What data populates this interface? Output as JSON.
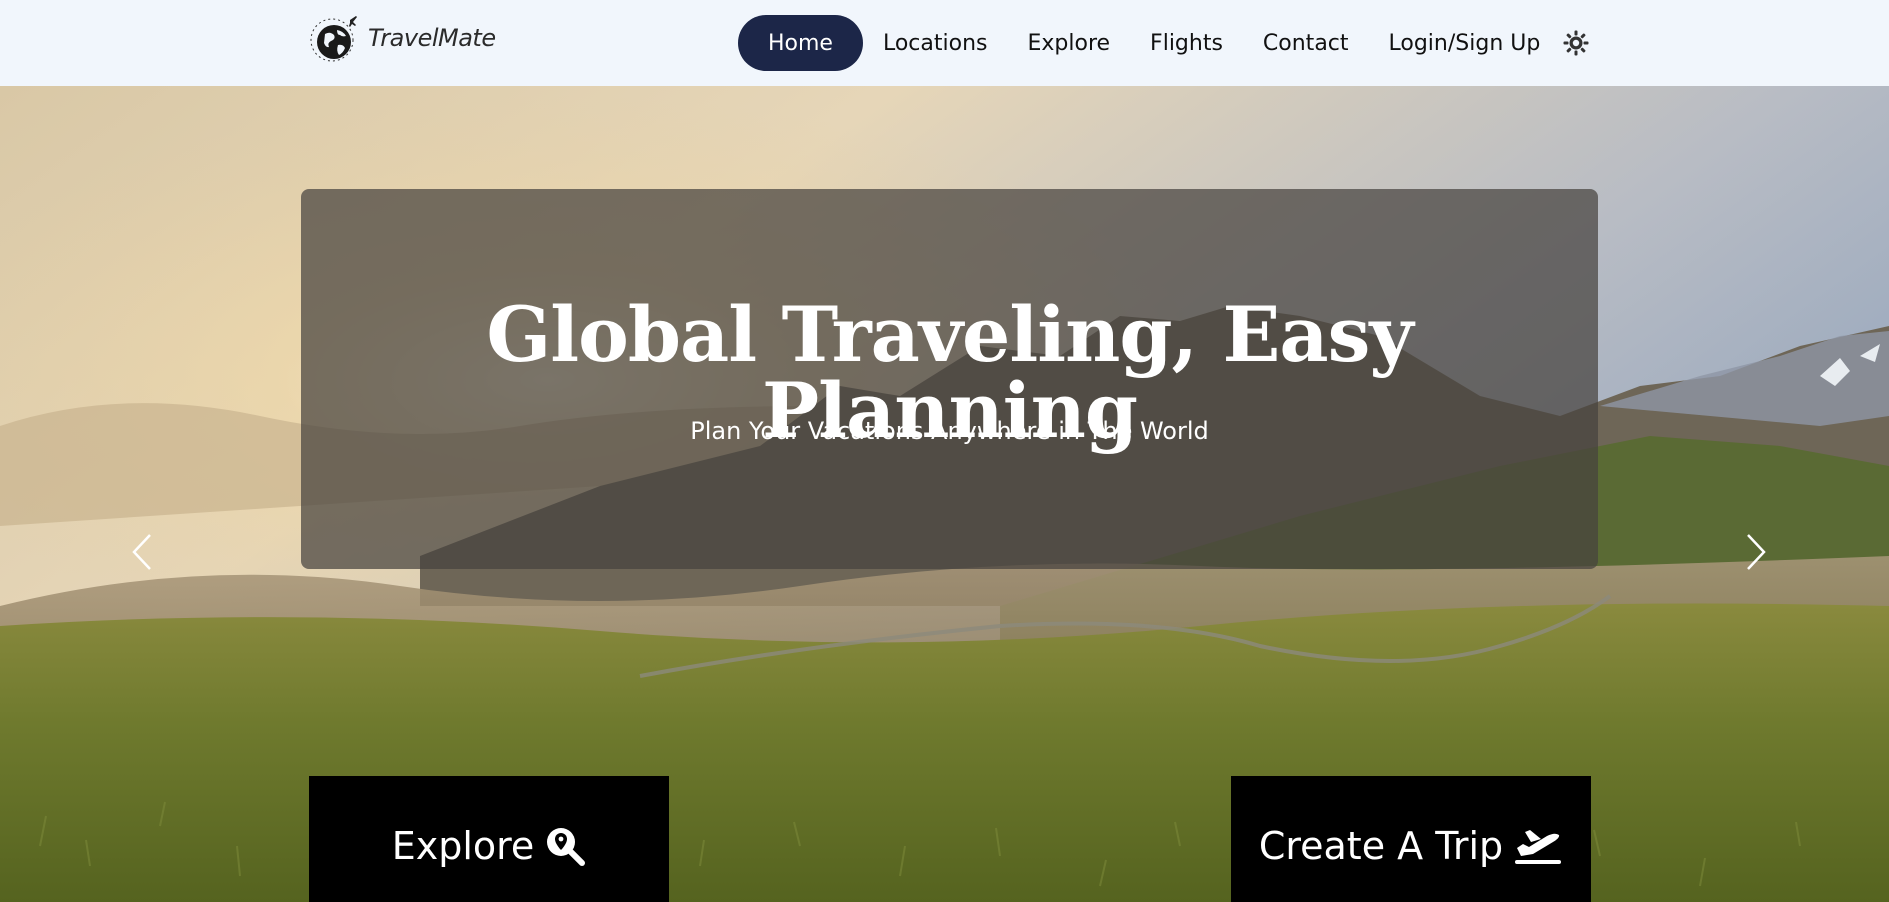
{
  "brand": {
    "name": "TravelMate",
    "icon": "globe-plane-logo"
  },
  "nav": {
    "items": [
      {
        "label": "Home",
        "active": true
      },
      {
        "label": "Locations",
        "active": false
      },
      {
        "label": "Explore",
        "active": false
      },
      {
        "label": "Flights",
        "active": false
      },
      {
        "label": "Contact",
        "active": false
      },
      {
        "label": "Login/Sign Up",
        "active": false
      }
    ],
    "theme_toggle_icon": "sun-icon",
    "active_color": "#1c2648"
  },
  "hero": {
    "title": "Global Traveling, Easy Planning",
    "subtitle": "Plan Your Vacations Anywhere in The World",
    "prev_icon": "chevron-left-icon",
    "next_icon": "chevron-right-icon"
  },
  "cta": {
    "explore_label": "Explore",
    "explore_icon": "search-location-icon",
    "trip_label": "Create A Trip",
    "trip_icon": "plane-departure-icon"
  }
}
